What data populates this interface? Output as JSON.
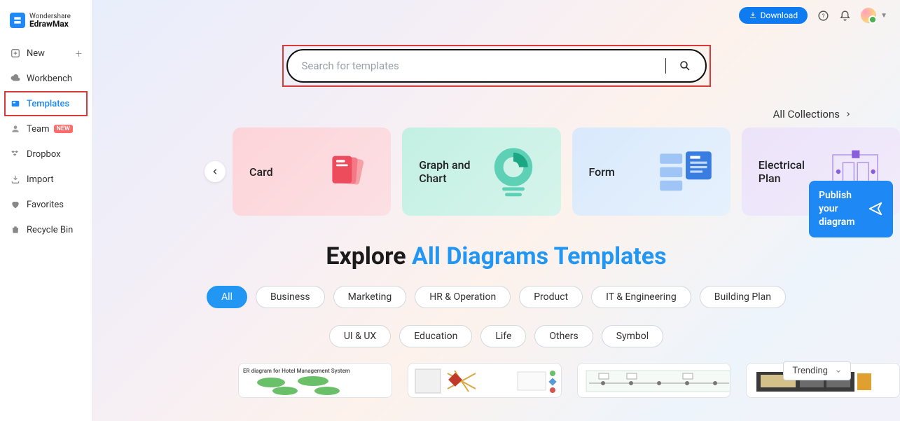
{
  "logo": {
    "line1": "Wondershare",
    "line2": "EdrawMax"
  },
  "sidebar": {
    "items": [
      {
        "label": "New",
        "icon": "plus-square",
        "plus": true
      },
      {
        "label": "Workbench",
        "icon": "cloud"
      },
      {
        "label": "Templates",
        "icon": "template",
        "active": true
      },
      {
        "label": "Team",
        "icon": "user",
        "badge": "NEW"
      },
      {
        "label": "Dropbox",
        "icon": "dropbox"
      },
      {
        "label": "Import",
        "icon": "import"
      },
      {
        "label": "Favorites",
        "icon": "heart"
      },
      {
        "label": "Recycle Bin",
        "icon": "trash"
      }
    ]
  },
  "topbar": {
    "download": "Download"
  },
  "search": {
    "placeholder": "Search for templates"
  },
  "all_collections": "All Collections",
  "cards": [
    {
      "label": "Card"
    },
    {
      "label": "Graph and Chart"
    },
    {
      "label": "Form"
    },
    {
      "label": "Electrical Plan"
    }
  ],
  "explore": {
    "prefix": "Explore ",
    "blue": "All Diagrams Templates"
  },
  "filters": {
    "row1": [
      "All",
      "Business",
      "Marketing",
      "HR & Operation",
      "Product",
      "IT & Engineering",
      "Building Plan"
    ],
    "row2": [
      "UI & UX",
      "Education",
      "Life",
      "Others",
      "Symbol"
    ]
  },
  "trending": "Trending",
  "templates": [
    {
      "caption": "ER diagram for Hotel Management System"
    },
    {
      "caption": ""
    },
    {
      "caption": ""
    },
    {
      "caption": ""
    }
  ],
  "publish": "Publish your diagram"
}
